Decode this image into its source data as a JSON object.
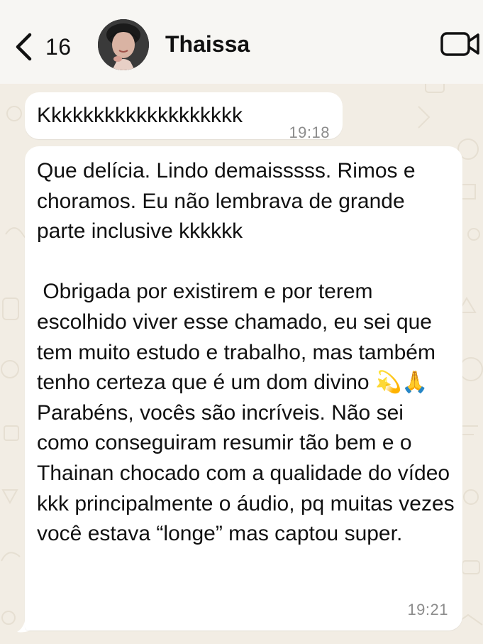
{
  "header": {
    "unread_count": "16",
    "contact_name": "Thaissa",
    "icons": {
      "back": "chevron-left-icon",
      "video": "video-camera-icon"
    }
  },
  "messages": [
    {
      "text": "Kkkkkkkkkkkkkkkkkkk",
      "time": "19:18"
    },
    {
      "text": "Que delícia. Lindo demaisssss. Rimos e choramos. Eu não lembrava de grande parte inclusive kkkkkk\n\n Obrigada por existirem e por terem escolhido viver esse chamado, eu sei que tem muito estudo e trabalho, mas também tenho certeza que é um dom divino 💫🙏\nParabéns, vocês são incríveis. Não sei como conseguiram resumir tão bem e o Thainan chocado com a qualidade do vídeo kkk principalmente o áudio, pq muitas vezes você estava “longe” mas captou super.",
      "time": "19:21"
    }
  ],
  "colors": {
    "header_bg": "#f7f6f3",
    "wallpaper_bg": "#f2ede4",
    "bubble_bg": "#ffffff",
    "time_text": "#8c8c8c"
  }
}
